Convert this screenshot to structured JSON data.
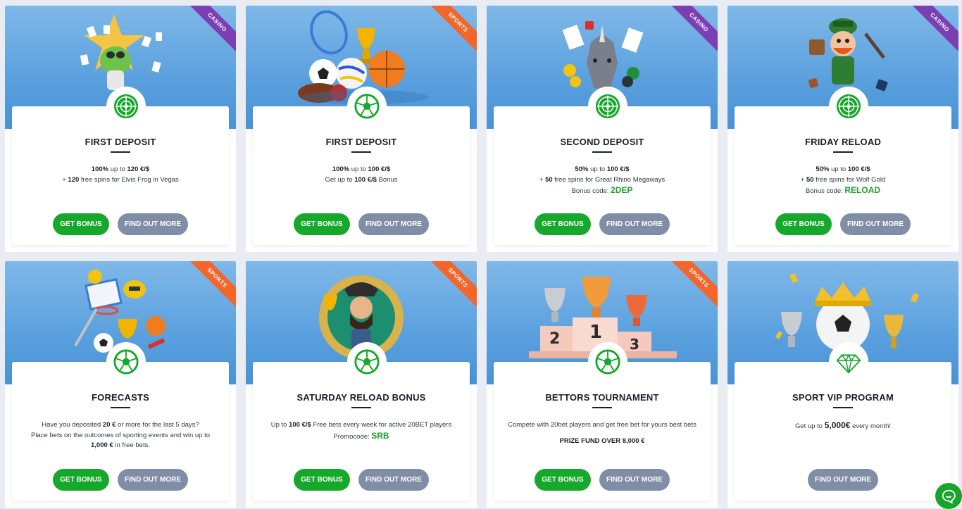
{
  "colors": {
    "accent_green": "#16a82a",
    "find_out_grey": "#7f8ea6",
    "casino_ribbon": "#7b3fb3",
    "sports_ribbon": "#f2662b",
    "code_green": "#1aa22f"
  },
  "cards": [
    {
      "ribbon": "CASINO",
      "ribbon_type": "casino",
      "badge_icon": "roulette-icon",
      "title": "FIRST DEPOSIT",
      "lines": [
        [
          "",
          "100%",
          " up to ",
          "120 €/$",
          ""
        ],
        [
          "+ ",
          "120",
          " free spins for Elvis Frog in Vegas",
          "",
          ""
        ]
      ],
      "get_bonus": "GET BONUS",
      "find_out_more": "FIND OUT MORE"
    },
    {
      "ribbon": "SPORTS",
      "ribbon_type": "sports",
      "badge_icon": "soccer-ball-icon",
      "title": "FIRST DEPOSIT",
      "lines": [
        [
          "",
          "100%",
          " up to ",
          "100 €/$",
          ""
        ],
        [
          "Get up to ",
          "100 €/$",
          " Bonus",
          "",
          ""
        ]
      ],
      "get_bonus": "GET BONUS",
      "find_out_more": "FIND OUT MORE"
    },
    {
      "ribbon": "CASINO",
      "ribbon_type": "casino",
      "badge_icon": "roulette-icon",
      "title": "SECOND DEPOSIT",
      "lines": [
        [
          "",
          "50%",
          " up to ",
          "100 €/$",
          ""
        ],
        [
          "+ ",
          "50",
          " free spins for Great Rhino Megaways",
          "",
          ""
        ]
      ],
      "code_label": "Bonus code: ",
      "code": "2DEP",
      "get_bonus": "GET BONUS",
      "find_out_more": "FIND OUT MORE"
    },
    {
      "ribbon": "CASINO",
      "ribbon_type": "casino",
      "badge_icon": "roulette-icon",
      "title": "FRIDAY RELOAD",
      "lines": [
        [
          "",
          "50%",
          " up to ",
          "100 €/$",
          ""
        ],
        [
          "+ ",
          "50",
          " free spins for Wolf Gold",
          "",
          ""
        ]
      ],
      "code_label": "Bonus code: ",
      "code": "RELOAD",
      "get_bonus": "GET BONUS",
      "find_out_more": "FIND OUT MORE"
    },
    {
      "ribbon": "SPORTS",
      "ribbon_type": "sports",
      "badge_icon": "soccer-ball-icon",
      "title": "FORECASTS",
      "lines": [
        [
          "Have you deposited ",
          "20 €",
          " or more for the last 5 days?",
          "",
          ""
        ],
        [
          "Place bets on the outcomes of sporting events and win up to",
          "",
          "",
          "",
          ""
        ],
        [
          "",
          "1,000 €",
          " in free bets.",
          "",
          ""
        ]
      ],
      "get_bonus": "GET BONUS",
      "find_out_more": "FIND OUT MORE"
    },
    {
      "ribbon": "SPORTS",
      "ribbon_type": "sports",
      "badge_icon": "soccer-ball-icon",
      "title": "SATURDAY RELOAD BONUS",
      "lines": [
        [
          "Up to ",
          "100 €/$",
          " Free bets every week for active 20BET players",
          "",
          ""
        ]
      ],
      "code_label": "Promocode: ",
      "code": "SRB",
      "get_bonus": "GET BONUS",
      "find_out_more": "FIND OUT MORE"
    },
    {
      "ribbon": "SPORTS",
      "ribbon_type": "sports",
      "badge_icon": "soccer-ball-icon",
      "title": "BETTORS TOURNAMENT",
      "lines": [
        [
          "Compete with 20bet players and get free bet for yours best bets",
          "",
          "",
          "",
          ""
        ]
      ],
      "fund": "PRIZE FUND OVER 8,000 €",
      "get_bonus": "GET BONUS",
      "find_out_more": "FIND OUT MORE"
    },
    {
      "ribbon": "",
      "ribbon_type": "",
      "badge_icon": "diamond-icon",
      "title": "SPORT VIP PROGRAM",
      "lines": [
        [
          "Get up to ",
          "5,000€",
          " every month!",
          "",
          ""
        ]
      ],
      "find_out_more": "FIND OUT MORE"
    }
  ],
  "chat": {
    "icon": "chat-icon"
  }
}
